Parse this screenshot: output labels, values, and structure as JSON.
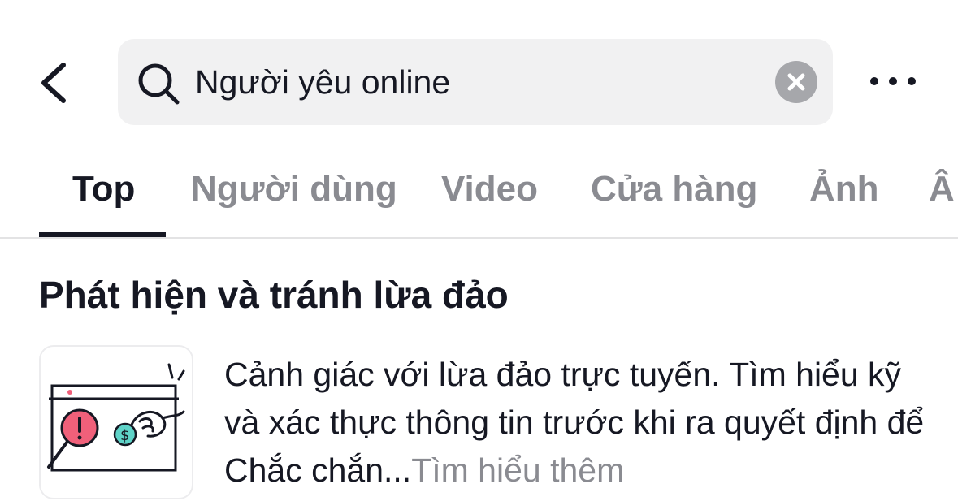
{
  "search": {
    "value": "Người yêu online"
  },
  "tabs": [
    {
      "label": "Top"
    },
    {
      "label": "Người dùng"
    },
    {
      "label": "Video"
    },
    {
      "label": "Cửa hàng"
    },
    {
      "label": "Ảnh"
    },
    {
      "label": "Â"
    }
  ],
  "active_tab": "Top",
  "section": {
    "title": "Phát hiện và tránh lừa đảo",
    "body": "Cảnh giác với lừa đảo trực tuyến. Tìm hiểu kỹ và xác thực thông tin trước khi ra quyết định để Chắc chắn...",
    "more_label": "Tìm hiểu thêm"
  },
  "icons": {
    "back": "chevron-left-icon",
    "search": "search-icon",
    "clear": "clear-x-icon",
    "more": "more-horizontal-icon",
    "thumbnail": "scam-warning-illustration"
  },
  "colors": {
    "text_primary": "#161823",
    "text_secondary": "#8a8b91",
    "search_bg": "#f1f1f2",
    "illustration_pink": "#f0607a",
    "illustration_teal": "#5fd3c8"
  }
}
